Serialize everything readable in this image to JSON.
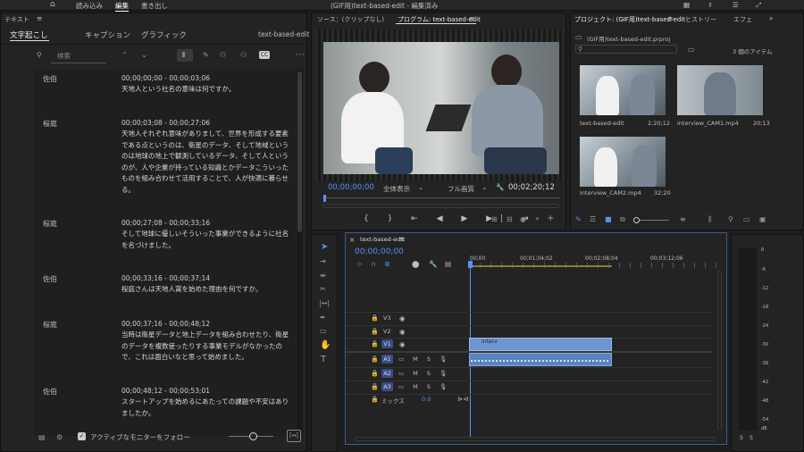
{
  "menu": {
    "tabs": [
      "読み込み",
      "編集",
      "書き出し"
    ],
    "active": "編集",
    "title": "(GIF用)text-based-edit - 編集済み"
  },
  "text_panel": {
    "title": "テキスト",
    "tabs": [
      "文字起こし",
      "キャプション",
      "グラフィック"
    ],
    "active_tab": "文字起こし",
    "sequence": "text-based-edit",
    "search_placeholder": "検索",
    "follow_label": "アクティブなモニターをフォロー",
    "blocks": [
      {
        "speaker": "佐伯",
        "tc": "00;00;00;00 - 00;00;03;06",
        "text": "天地人という社名の意味は何ですか。"
      },
      {
        "speaker": "桜庭",
        "tc": "00;00;03;08 - 00;00;27;06",
        "text": "天地人それぞれ意味がありまして、世界を形成する要素である点というのは、衛星のデータ、そして地域というのは地球の地上で観測しているデータ、そして人というのが、人や企業が持っている知識とかデータこういったものを組み合わせて活用することで、人が快適に暮らせる。"
      },
      {
        "speaker": "桜庭",
        "tc": "00;00;27;08 - 00;00;33;16",
        "text": "そして地球に優しいそういった事業ができるように社名を名づけました。"
      },
      {
        "speaker": "佐伯",
        "tc": "00;00;33;16 - 00;00;37;14",
        "text": "桜庭さんは天地人賞を始めた理由を何ですか。"
      },
      {
        "speaker": "桜庭",
        "tc": "00;00;37;16 - 00;00;48;12",
        "text": "当時は衛星データと地上データを組み合わせたり、衛星のデータを複数使ったりする事業モデルがなかったので、これは面白いなと思って始めました。"
      },
      {
        "speaker": "佐伯",
        "tc": "00;00;48;12 - 00;00;53;01",
        "text": "スタートアップを始めるにあたっての課題や不安はありましたか。"
      }
    ]
  },
  "source": {
    "label": "ソース：(クリップなし)"
  },
  "program": {
    "label": "プログラム: text-based-edit",
    "timecode": "00;00;00;00",
    "zoom": "全体表示",
    "quality": "フル画質",
    "duration": "00;02;20;12"
  },
  "project": {
    "tabs": [
      "プロジェクト: (GIF用)text-based-edit",
      "ヒストリー",
      "エフェ"
    ],
    "file": "(GIF用)text-based-edit.prproj",
    "count": "3 個のアイテム",
    "items": [
      {
        "name": "text-based-edit",
        "dur": "2;20;12"
      },
      {
        "name": "interview_CAM1.mp4",
        "dur": "20;13"
      },
      {
        "name": "interview_CAM2.mp4",
        "dur": "32;20"
      }
    ]
  },
  "timeline": {
    "tab": "text-based-edit",
    "timecode": "00;00;00;00",
    "ruler": [
      "00;00",
      "00;01;04;02",
      "00;02;08;04",
      "00;03;12;06"
    ],
    "tracks": [
      "V3",
      "V2",
      "V1",
      "A1",
      "A2",
      "A3"
    ],
    "mix": "ミックス",
    "mix_val": "0.0",
    "clip": "interv"
  },
  "meter": {
    "scale": [
      "0",
      "-6",
      "-12",
      "-18",
      "-24",
      "-30",
      "-36",
      "-42",
      "-48",
      "-54",
      "dB"
    ],
    "solo": [
      "S",
      "S"
    ]
  }
}
